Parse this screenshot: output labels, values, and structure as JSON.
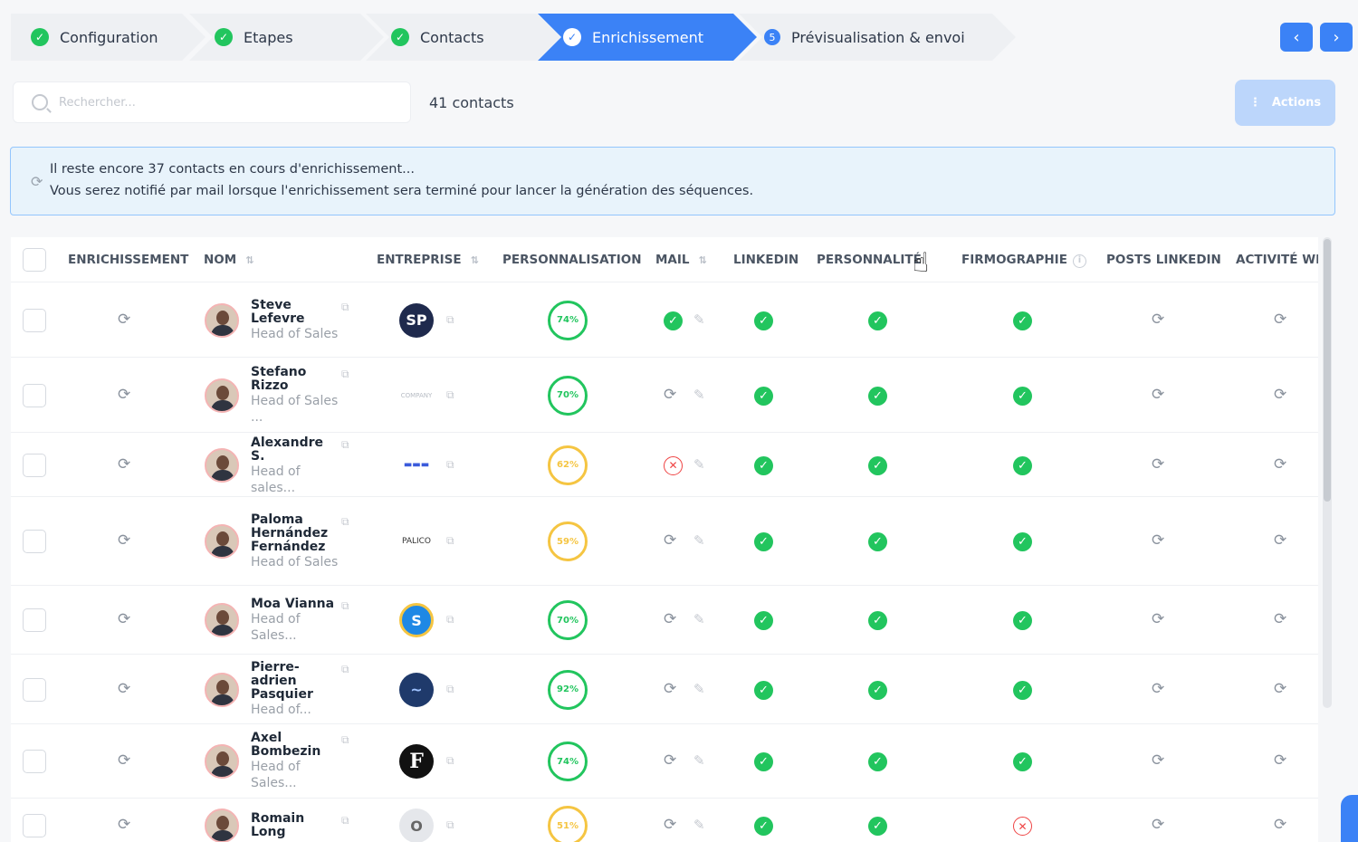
{
  "stepper": [
    {
      "label": "Configuration",
      "state": "done",
      "icon": "check-icon"
    },
    {
      "label": "Etapes",
      "state": "done",
      "icon": "check-icon"
    },
    {
      "label": "Contacts",
      "state": "done",
      "icon": "check-icon"
    },
    {
      "label": "Enrichissement",
      "state": "active",
      "icon": "check-icon"
    },
    {
      "label": "Prévisualisation & envoi",
      "state": "pending",
      "number": "5"
    }
  ],
  "nav": {
    "prev": "‹",
    "next": "›"
  },
  "search": {
    "placeholder": "Rechercher..."
  },
  "contacts_count": "41 contacts",
  "actions_label": "Actions",
  "banner": {
    "line1": "Il reste encore 37 contacts en cours d'enrichissement...",
    "line2": "Vous serez notifié par mail lorsque l'enrichissement sera terminé pour lancer la génération des séquences."
  },
  "columns": {
    "enrichissement": "ENRICHISSEMENT",
    "nom": "NOM",
    "entreprise": "ENTREPRISE",
    "personnalisation": "PERSONNALISATION",
    "mail": "MAIL",
    "linkedin": "LINKEDIN",
    "personnalite": "PERSONNALITÉ",
    "firmographie": "FIRMOGRAPHIE",
    "posts_linkedin": "POSTS LINKEDIN",
    "activite_web": "ACTIVITÉ WE"
  },
  "rows": [
    {
      "name": "Steve Lefevre",
      "role": "Head of Sales",
      "company_logo": "SP",
      "personalization": "74%",
      "mail": "ok",
      "linkedin": "ok",
      "personnalite": "ok",
      "firmographie": "ok"
    },
    {
      "name": "Stefano Rizzo",
      "role": "Head of Sales ...",
      "company_logo": "COMPANY",
      "personalization": "70%",
      "mail": "pending",
      "linkedin": "ok",
      "personnalite": "ok",
      "firmographie": "ok"
    },
    {
      "name": "Alexandre S.",
      "role": "Head of sales...",
      "company_logo": "▬▬▬",
      "personalization": "62%",
      "mail": "error",
      "linkedin": "ok",
      "personnalite": "ok",
      "firmographie": "ok"
    },
    {
      "name": "Paloma Hernández Fernández",
      "role": "Head of Sales",
      "company_logo": "PALICO",
      "personalization": "59%",
      "mail": "pending",
      "linkedin": "ok",
      "personnalite": "ok",
      "firmographie": "ok"
    },
    {
      "name": "Moa Vianna",
      "role": "Head of Sales...",
      "company_logo": "S",
      "personalization": "70%",
      "mail": "pending",
      "linkedin": "ok",
      "personnalite": "ok",
      "firmographie": "ok"
    },
    {
      "name": "Pierre-adrien Pasquier",
      "role": "Head of...",
      "company_logo": "~",
      "personalization": "92%",
      "mail": "pending",
      "linkedin": "ok",
      "personnalite": "ok",
      "firmographie": "ok"
    },
    {
      "name": "Axel Bombezin",
      "role": "Head of Sales...",
      "company_logo": "F",
      "personalization": "74%",
      "mail": "pending",
      "linkedin": "ok",
      "personnalite": "ok",
      "firmographie": "ok"
    },
    {
      "name": "Romain Long",
      "role": "",
      "company_logo": "O",
      "personalization": "51%",
      "mail": "pending",
      "linkedin": "ok",
      "personnalite": "ok",
      "firmographie": "error"
    }
  ],
  "colors": {
    "accent": "#3b82f6",
    "success": "#22c55e",
    "error": "#ef4444",
    "warning": "#f5c542"
  }
}
